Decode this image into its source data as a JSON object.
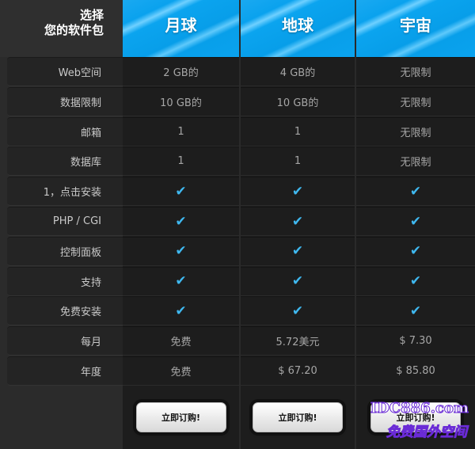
{
  "header": {
    "corner_line1": "选择",
    "corner_line2": "您的软件包",
    "plans": [
      "月球",
      "地球",
      "宇宙"
    ]
  },
  "features": [
    {
      "label": "Web空间",
      "values": [
        "2 GB的",
        "4 GB的",
        "无限制"
      ]
    },
    {
      "label": "数据限制",
      "values": [
        "10 GB的",
        "10 GB的",
        "无限制"
      ]
    },
    {
      "label": "邮箱",
      "values": [
        "1",
        "1",
        "无限制"
      ]
    },
    {
      "label": "数据库",
      "values": [
        "1",
        "1",
        "无限制"
      ]
    },
    {
      "label": "1，点击安装",
      "values": [
        "✔",
        "✔",
        "✔"
      ]
    },
    {
      "label": "PHP / CGI",
      "values": [
        "✔",
        "✔",
        "✔"
      ]
    },
    {
      "label": "控制面板",
      "values": [
        "✔",
        "✔",
        "✔"
      ]
    },
    {
      "label": "支持",
      "values": [
        "✔",
        "✔",
        "✔"
      ]
    },
    {
      "label": "免费安装",
      "values": [
        "✔",
        "✔",
        "✔"
      ]
    },
    {
      "label": "每月",
      "values": [
        "免费",
        "5.72美元",
        "$ 7.30"
      ]
    },
    {
      "label": "年度",
      "values": [
        "免费",
        "$ 67.20",
        "$ 85.80"
      ]
    }
  ],
  "buttons": {
    "order_label": "立即订购!"
  },
  "watermark": {
    "line1": "IDC886.com",
    "line2": "免费国外空间"
  },
  "colors": {
    "accent": "#0aa3ee",
    "check": "#3fb8ef"
  }
}
